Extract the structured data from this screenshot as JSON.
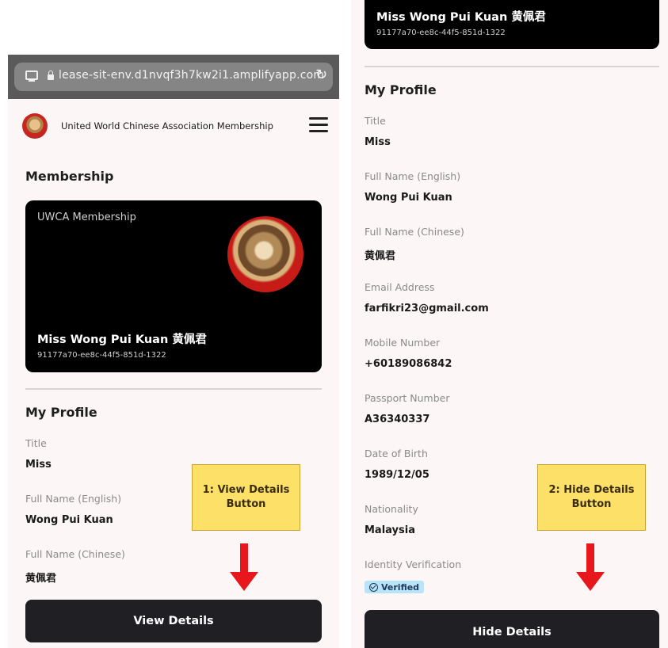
{
  "browser": {
    "url": "lease-sit-env.d1nvqf3h7kw2i1.amplifyapp.com"
  },
  "header": {
    "org_name": "United World Chinese Association Membership"
  },
  "membership": {
    "section_title": "Membership",
    "card_type": "UWCA Membership",
    "card_name": "Miss Wong Pui Kuan 黄佩君",
    "card_id": "91177a70-ee8c-44f5-851d-1322"
  },
  "profile": {
    "section_title": "My Profile",
    "fields": [
      {
        "label": "Title",
        "value": "Miss"
      },
      {
        "label": "Full Name (English)",
        "value": "Wong Pui Kuan"
      },
      {
        "label": "Full Name (Chinese)",
        "value": "黄佩君"
      },
      {
        "label": "Email Address",
        "value": "farfikri23@gmail.com"
      },
      {
        "label": "Mobile Number",
        "value": "+60189086842"
      },
      {
        "label": "Passport Number",
        "value": "A36340337"
      },
      {
        "label": "Date of Birth",
        "value": "1989/12/05"
      },
      {
        "label": "Nationality",
        "value": "Malaysia"
      },
      {
        "label": "Identity Verification",
        "value": "Verified"
      }
    ]
  },
  "buttons": {
    "view_details": "View Details",
    "hide_details": "Hide Details"
  },
  "callouts": {
    "step1_line1": "1: View Details",
    "step1_line2": "Button",
    "step2_line1": "2: Hide Details",
    "step2_line2": "Button"
  },
  "colors": {
    "button_bg": "#1f1f24",
    "callout_bg": "#fce067",
    "arrow": "#e8171b",
    "badge_bg": "#b9e3f7"
  },
  "icons": [
    "tab-overview-icon",
    "lock-icon",
    "reload-icon",
    "hamburger-menu-icon",
    "check-circle-icon",
    "arrow-down-icon"
  ]
}
